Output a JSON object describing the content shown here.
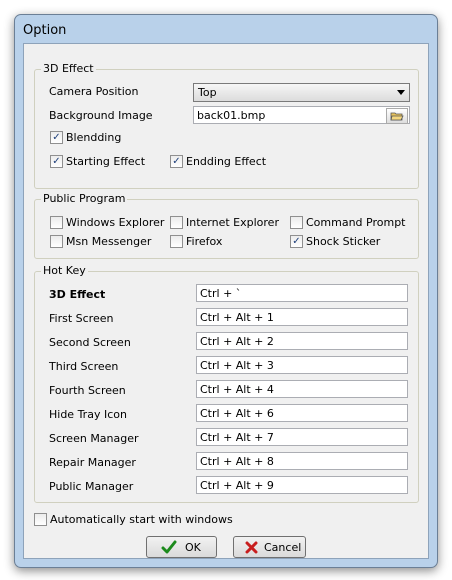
{
  "window": {
    "title": "Option"
  },
  "effect": {
    "legend": "3D Effect",
    "camera_label": "Camera Position",
    "camera_value": "Top",
    "bg_label": "Background Image",
    "bg_value": "back01.bmp",
    "blending": {
      "label": "Blendding",
      "checked": true
    },
    "starting": {
      "label": "Starting Effect",
      "checked": true
    },
    "ending": {
      "label": "Endding Effect",
      "checked": true
    }
  },
  "programs": {
    "legend": "Public Program",
    "items": [
      {
        "label": "Windows Explorer",
        "checked": false
      },
      {
        "label": "Internet Explorer",
        "checked": false
      },
      {
        "label": "Command Prompt",
        "checked": false
      },
      {
        "label": "Msn Messenger",
        "checked": false
      },
      {
        "label": "Firefox",
        "checked": false
      },
      {
        "label": "Shock Sticker",
        "checked": true
      }
    ]
  },
  "hotkeys": {
    "legend": "Hot Key",
    "items": [
      {
        "label": "3D Effect",
        "value": "Ctrl + `"
      },
      {
        "label": "First Screen",
        "value": "Ctrl + Alt + 1"
      },
      {
        "label": "Second Screen",
        "value": "Ctrl + Alt + 2"
      },
      {
        "label": "Third Screen",
        "value": "Ctrl + Alt + 3"
      },
      {
        "label": "Fourth Screen",
        "value": "Ctrl + Alt + 4"
      },
      {
        "label": "Hide Tray Icon",
        "value": "Ctrl + Alt + 6"
      },
      {
        "label": "Screen Manager",
        "value": "Ctrl + Alt + 7"
      },
      {
        "label": "Repair Manager",
        "value": "Ctrl + Alt + 8"
      },
      {
        "label": "Public Manager",
        "value": "Ctrl + Alt + 9"
      }
    ]
  },
  "autostart": {
    "label": "Automatically start with windows",
    "checked": false
  },
  "buttons": {
    "ok": "OK",
    "cancel": "Cancel"
  },
  "icons": {
    "ok": "checkmark-icon",
    "cancel": "cross-icon",
    "browse": "open-folder-icon"
  },
  "colors": {
    "ok_icon": "#1c8a1c",
    "cancel_icon": "#c81e1e"
  }
}
